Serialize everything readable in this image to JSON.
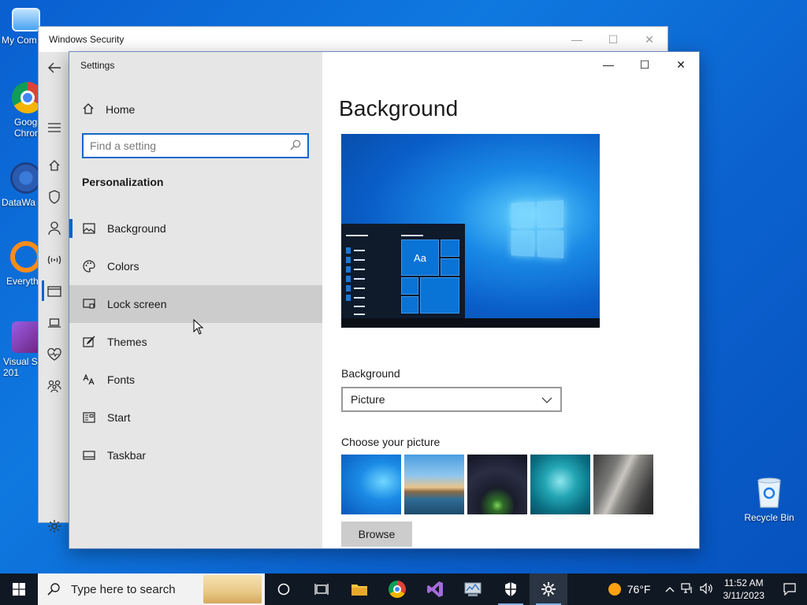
{
  "desktop": {
    "icons": [
      {
        "label": "My Com"
      },
      {
        "label": "Goog\nChrom"
      },
      {
        "label": "DataWa"
      },
      {
        "label": "Everyth"
      },
      {
        "label": "Visual St\n201"
      }
    ],
    "recycle_bin": "Recycle Bin"
  },
  "security_window": {
    "title": "Windows Security"
  },
  "settings": {
    "title": "Settings",
    "home": "Home",
    "search_placeholder": "Find a setting",
    "section": "Personalization",
    "nav": [
      {
        "label": "Background",
        "icon": "picture-icon",
        "selected": true
      },
      {
        "label": "Colors",
        "icon": "palette-icon"
      },
      {
        "label": "Lock screen",
        "icon": "lock-screen-icon",
        "hover": true
      },
      {
        "label": "Themes",
        "icon": "brush-icon"
      },
      {
        "label": "Fonts",
        "icon": "font-icon"
      },
      {
        "label": "Start",
        "icon": "start-menu-icon"
      },
      {
        "label": "Taskbar",
        "icon": "taskbar-icon"
      }
    ],
    "content": {
      "page_title": "Background",
      "preview_tile_label": "Aa",
      "background_label": "Background",
      "background_value": "Picture",
      "choose_label": "Choose your picture",
      "browse_label": "Browse"
    }
  },
  "taskbar": {
    "search_placeholder": "Type here to search",
    "weather_temp": "76°F",
    "time": "11:52 AM",
    "date": "3/11/2023"
  }
}
